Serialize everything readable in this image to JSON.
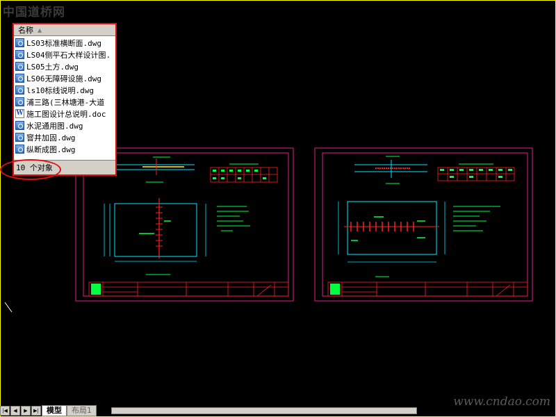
{
  "watermark": {
    "top": "中国道桥网",
    "bottom": "www.cndao.com"
  },
  "file_panel": {
    "column_header": "名称",
    "files": [
      {
        "name": "LS03标准横断面.dwg",
        "icon": "dwg-file-icon"
      },
      {
        "name": "LS04侧平石大样设计图.",
        "icon": "dwg-file-icon"
      },
      {
        "name": "LS05土方.dwg",
        "icon": "dwg-file-icon"
      },
      {
        "name": "LS06无障碍设施.dwg",
        "icon": "dwg-file-icon"
      },
      {
        "name": "ls10标线说明.dwg",
        "icon": "dwg-file-icon"
      },
      {
        "name": "浦三路(三林塘港-大道",
        "icon": "dwg-file-icon"
      },
      {
        "name": "施工图设计总说明.doc",
        "icon": "word-doc-icon"
      },
      {
        "name": "水泥通用图.dwg",
        "icon": "dwg-file-icon"
      },
      {
        "name": "窨井加固.dwg",
        "icon": "dwg-file-icon"
      },
      {
        "name": "纵断成图.dwg",
        "icon": "dwg-file-icon"
      }
    ],
    "status": "10 个对象"
  },
  "tabs": {
    "model": "模型",
    "layout1": "布局1"
  },
  "colors": {
    "background": "#000000",
    "frame": "#ffff00",
    "sheet_border": "#e0208a",
    "drawing_cyan": "#00e8ff",
    "drawing_green": "#00ff40",
    "drawing_red": "#ff2020",
    "highlight_red": "#e01010"
  }
}
